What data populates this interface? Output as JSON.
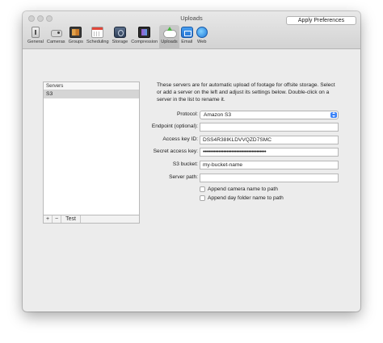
{
  "window": {
    "title": "Uploads",
    "apply_button": "Apply Preferences"
  },
  "toolbar": {
    "items": [
      {
        "label": "General",
        "icon": "general-icon"
      },
      {
        "label": "Cameras",
        "icon": "camera-icon"
      },
      {
        "label": "Groups",
        "icon": "groups-icon"
      },
      {
        "label": "Scheduling",
        "icon": "calendar-icon"
      },
      {
        "label": "Storage",
        "icon": "storage-icon"
      },
      {
        "label": "Compression",
        "icon": "compression-icon"
      },
      {
        "label": "Uploads",
        "icon": "upload-cloud-icon",
        "active": true
      },
      {
        "label": "Email",
        "icon": "email-icon"
      },
      {
        "label": "Web",
        "icon": "web-icon"
      }
    ]
  },
  "servers": {
    "header": "Servers",
    "items": [
      "S3"
    ],
    "selected": "S3",
    "footer": {
      "add": "+",
      "remove": "−",
      "test": "Test"
    }
  },
  "description": "These servers are for automatic upload of footage for offsite storage. Select or add a server on the left and adjust its settings below. Double-click on a server in the list to rename it.",
  "form": {
    "protocol": {
      "label": "Protocol:",
      "value": "Amazon S3"
    },
    "endpoint": {
      "label": "Endpoint (optional):",
      "value": ""
    },
    "access_key": {
      "label": "Access key ID:",
      "value": "DSS4R38IKLDVVQZD7SMC"
    },
    "secret_key": {
      "label": "Secret access key:",
      "value": "••••••••••••••••••••••••••••••••••••••••"
    },
    "bucket": {
      "label": "S3 bucket:",
      "value": "my-bucket-name"
    },
    "server_path": {
      "label": "Server path:",
      "value": ""
    },
    "append_camera": {
      "label": "Append camera name to path",
      "checked": false
    },
    "append_day": {
      "label": "Append day folder name to path",
      "checked": false
    }
  },
  "colors": {
    "accent": "#3b82f6",
    "window_bg": "#ececec",
    "selection": "#d5d5d5"
  }
}
